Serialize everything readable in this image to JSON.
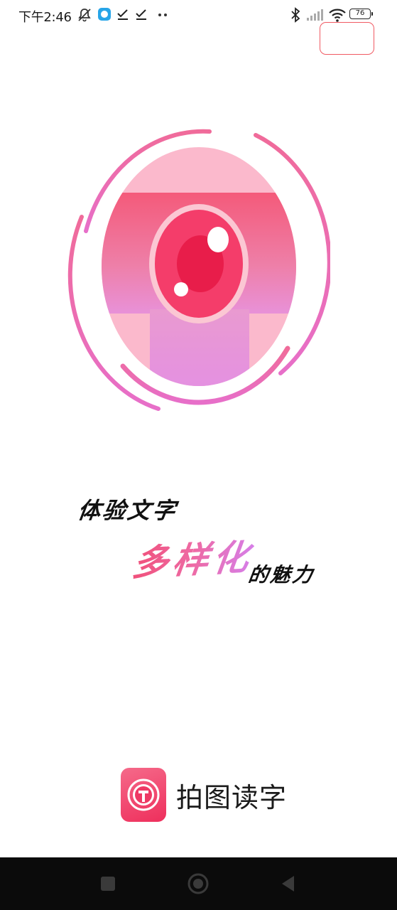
{
  "status_bar": {
    "time": "下午2:46",
    "battery_level": "76",
    "icons": [
      "mute-bell-icon",
      "app-notification-icon",
      "check-icon",
      "check-icon",
      "more-dots-icon",
      "bluetooth-icon",
      "signal-icon",
      "wifi-icon",
      "battery-icon"
    ]
  },
  "skip_button": {
    "label": ""
  },
  "slogan": {
    "line1": "体验文字",
    "highlight": "多样化",
    "line3": "的魅力"
  },
  "brand": {
    "app_name": "拍图读字",
    "icon": "app-logo-icon"
  },
  "colors": {
    "accent": "#f0507a",
    "gradient_end": "#e88ee6",
    "nav_bar": "#0b0b0b"
  },
  "nav": {
    "buttons": [
      "recent-apps-icon",
      "home-icon",
      "back-icon"
    ]
  }
}
